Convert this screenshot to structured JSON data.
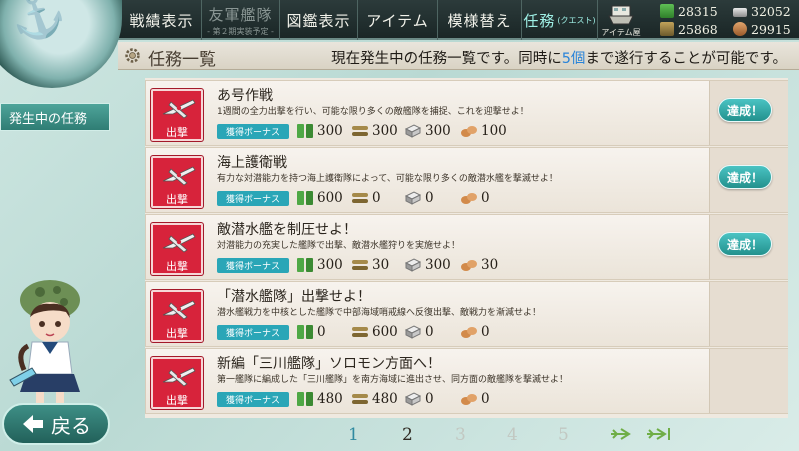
{
  "nav": {
    "items": [
      {
        "label": "戦績表示"
      },
      {
        "label": "友軍艦隊",
        "sub": "- 第２期実装予定 -"
      },
      {
        "label": "図鑑表示"
      },
      {
        "label": "アイテム"
      },
      {
        "label": "模様替え"
      },
      {
        "label": "任務",
        "small": "(クエスト)"
      }
    ],
    "item_shop_label": "アイテム屋"
  },
  "resources": {
    "fuel": "28315",
    "ammo": "25868",
    "steel": "32052",
    "bauxite": "29915"
  },
  "header": {
    "title": "任務一覧",
    "desc_before": "現在発生中の任務一覧です。同時に",
    "desc_num": "5個",
    "desc_after": "まで遂行することが可能です。"
  },
  "side_tab": "発生中の任務",
  "back_button": "戻る",
  "quests": [
    {
      "type": "出撃",
      "title": "あ号作戦",
      "desc": "1週間の全力出撃を行い、可能な限り多くの敵艦隊を捕捉、これを迎撃せよ！",
      "bonus": "獲得ボーナス",
      "rewards": {
        "fuel": "300",
        "ammo": "300",
        "steel": "300",
        "bauxite": "100"
      },
      "status": "達成！"
    },
    {
      "type": "出撃",
      "title": "海上護衛戦",
      "desc": "有力な対潜能力を持つ海上護衛隊によって、可能な限り多くの敵潜水艦を撃滅せよ！",
      "bonus": "獲得ボーナス",
      "rewards": {
        "fuel": "600",
        "ammo": "0",
        "steel": "0",
        "bauxite": "0"
      },
      "status": "達成！"
    },
    {
      "type": "出撃",
      "title": "敵潜水艦を制圧せよ！",
      "desc": "対潜能力の充実した艦隊で出撃、敵潜水艦狩りを実施せよ！",
      "bonus": "獲得ボーナス",
      "rewards": {
        "fuel": "300",
        "ammo": "30",
        "steel": "300",
        "bauxite": "30"
      },
      "status": "達成！"
    },
    {
      "type": "出撃",
      "title": "「潜水艦隊」出撃せよ！",
      "desc": "潜水艦戦力を中核とした艦隊で中部海域哨戒線へ反復出撃、敵戦力を漸減せよ！",
      "bonus": "獲得ボーナス",
      "rewards": {
        "fuel": "0",
        "ammo": "600",
        "steel": "0",
        "bauxite": "0"
      },
      "status": ""
    },
    {
      "type": "出撃",
      "title": "新編「三川艦隊」ソロモン方面へ！",
      "desc": "第一艦隊に編成した「三川艦隊」を南方海域に進出させ、同方面の敵艦隊を撃滅せよ！",
      "bonus": "獲得ボーナス",
      "rewards": {
        "fuel": "480",
        "ammo": "480",
        "steel": "0",
        "bauxite": "0"
      },
      "status": ""
    }
  ],
  "pagination": {
    "pages": [
      "1",
      "2",
      "3",
      "4",
      "5"
    ],
    "current": "1"
  },
  "colors": {
    "accent": "#2a84d9",
    "sortie_red": "#d7233b",
    "bonus_teal": "#2aa6b7",
    "achieved_teal": "#23918d"
  }
}
